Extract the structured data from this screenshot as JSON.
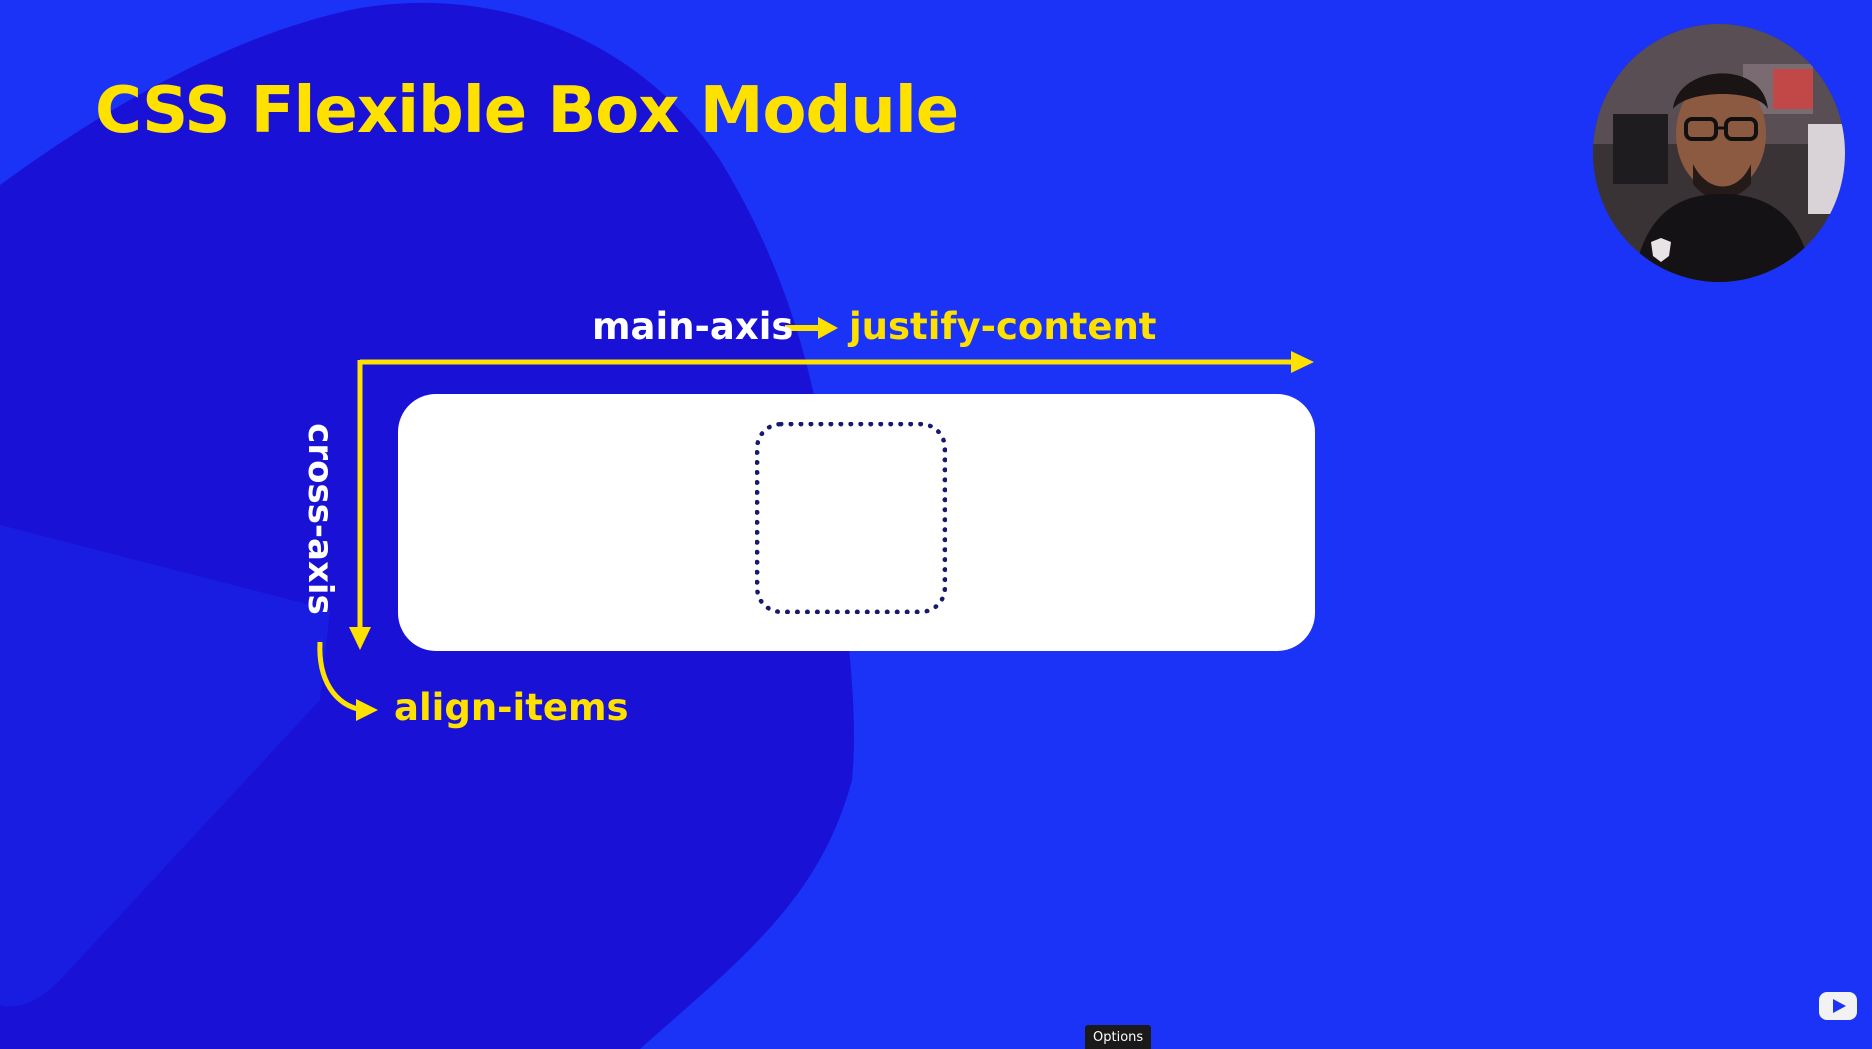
{
  "slide": {
    "title": "CSS Flexible Box Module",
    "main_axis_label": "main-axis",
    "justify_label": "justify-content",
    "cross_axis_label": "cross-axis",
    "align_label": "align-items"
  },
  "player": {
    "tooltip_text": "Options"
  },
  "icons": {
    "arrows": "arrow-icon",
    "logo": "youtube-logo-icon"
  },
  "colors": {
    "background": "#1b32f7",
    "blob": "#1912d6",
    "accent_yellow": "#ffe100",
    "item_border": "#161a6e"
  }
}
